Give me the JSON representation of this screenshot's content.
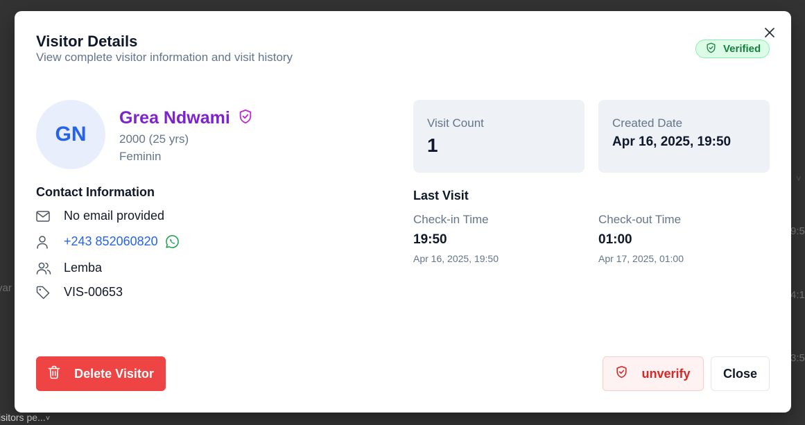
{
  "background": {
    "fragments": [
      "9:5",
      "4:1",
      "3:5",
      "yar"
    ],
    "footer_text": "isitors pe...",
    "footer_chevron": "˅",
    "chevron": "˅"
  },
  "modal": {
    "title": "Visitor Details",
    "subtitle": "View complete visitor information and visit history",
    "verified_label": "Verified",
    "close_icon": "×"
  },
  "visitor": {
    "initials": "GN",
    "name": "Grea Ndwami",
    "birth": "2000 (25 yrs)",
    "gender": "Feminin"
  },
  "contact": {
    "title": "Contact Information",
    "email": "No email provided",
    "phone": "+243 852060820",
    "location": "Lemba",
    "visitor_id": "VIS-00653"
  },
  "stats": {
    "visit_count_label": "Visit Count",
    "visit_count": "1",
    "created_label": "Created Date",
    "created_value": "Apr 16, 2025, 19:50"
  },
  "last_visit": {
    "title": "Last Visit",
    "check_in_label": "Check-in Time",
    "check_in_time": "19:50",
    "check_in_date": "Apr 16, 2025, 19:50",
    "check_out_label": "Check-out Time",
    "check_out_time": "01:00",
    "check_out_date": "Apr 17, 2025, 01:00"
  },
  "buttons": {
    "delete": "Delete Visitor",
    "unverify": "unverify",
    "close": "Close"
  },
  "colors": {
    "accent_purple": "#7e22ce",
    "link_blue": "#2563eb",
    "danger_red": "#ef4444",
    "verified_green": "#15803d",
    "whatsapp_green": "#16a34a"
  }
}
